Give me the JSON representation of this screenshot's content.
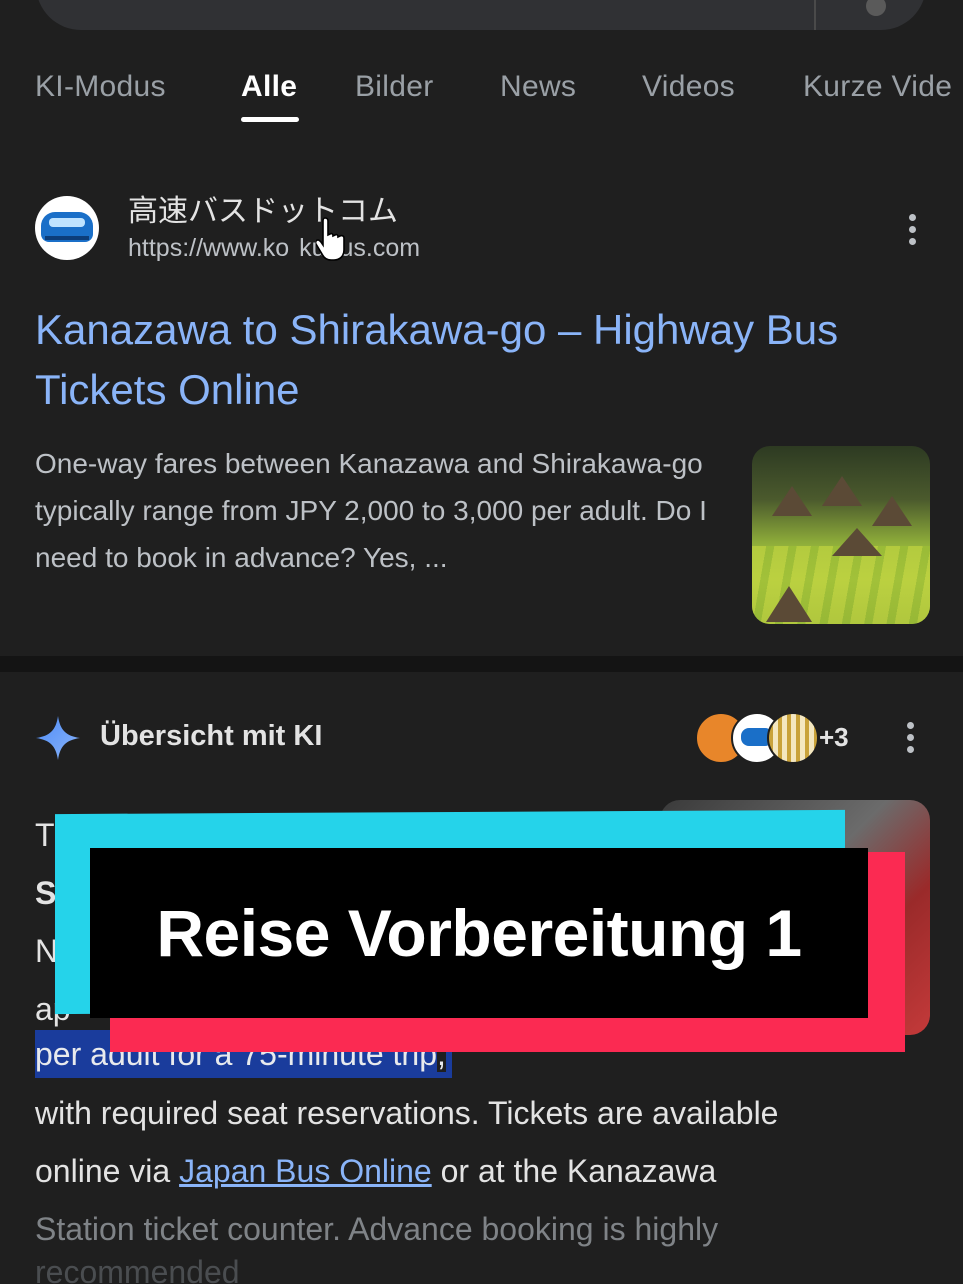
{
  "tabs": [
    {
      "label": "KI-Modus"
    },
    {
      "label": "Alle"
    },
    {
      "label": "Bilder"
    },
    {
      "label": "News"
    },
    {
      "label": "Videos"
    },
    {
      "label": "Kurze Vide"
    }
  ],
  "active_tab": "Alle",
  "result": {
    "site_name": "高速バスドットコム",
    "url": "https://www.ko  kubus.com",
    "title": "Kanazawa to Shirakawa-go – Highway Bus Tickets Online",
    "snippet": "One-way fares between Kanazawa and Shirakawa-go typically range from JPY 2,000 to 3,000 per adult. Do I need to book in advance? Yes, ..."
  },
  "ai_overview": {
    "heading": "Übersicht mit KI",
    "sources_more": "+3",
    "partial_lines": [
      "T",
      "S",
      "N",
      "ap"
    ],
    "highlight": "per adult for a 75-minute trip",
    "highlight_suffix": ",",
    "line1": "with required seat reservations. Tickets are available",
    "line2_pre": "online via ",
    "line2_link": "Japan Bus Online",
    "line2_post": " or at the Kanazawa",
    "line3": "Station ticket counter. Advance booking is highly",
    "line4": "recommended"
  },
  "overlay": {
    "caption": "Reise Vorbereitung 1"
  }
}
